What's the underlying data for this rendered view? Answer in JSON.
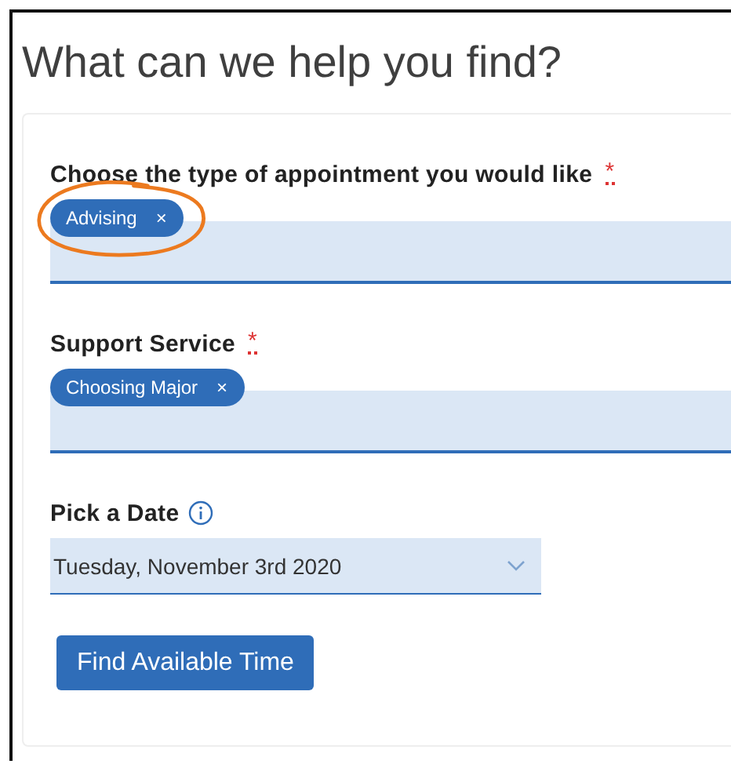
{
  "title": "What can we help you find?",
  "fields": [
    {
      "kind": "chips",
      "label": "Choose the type of appointment you would like",
      "required_mark": "*",
      "chips": [
        "Advising"
      ],
      "chip_remove": "×",
      "annotated": true
    },
    {
      "kind": "chips",
      "label": "Support Service",
      "required_mark": "*",
      "chips": [
        "Choosing Major"
      ],
      "chip_remove": "×",
      "annotated": false
    },
    {
      "kind": "select",
      "label": "Pick a Date",
      "info": true,
      "value": "Tuesday, November 3rd 2020"
    }
  ],
  "button": "Find Available Time"
}
